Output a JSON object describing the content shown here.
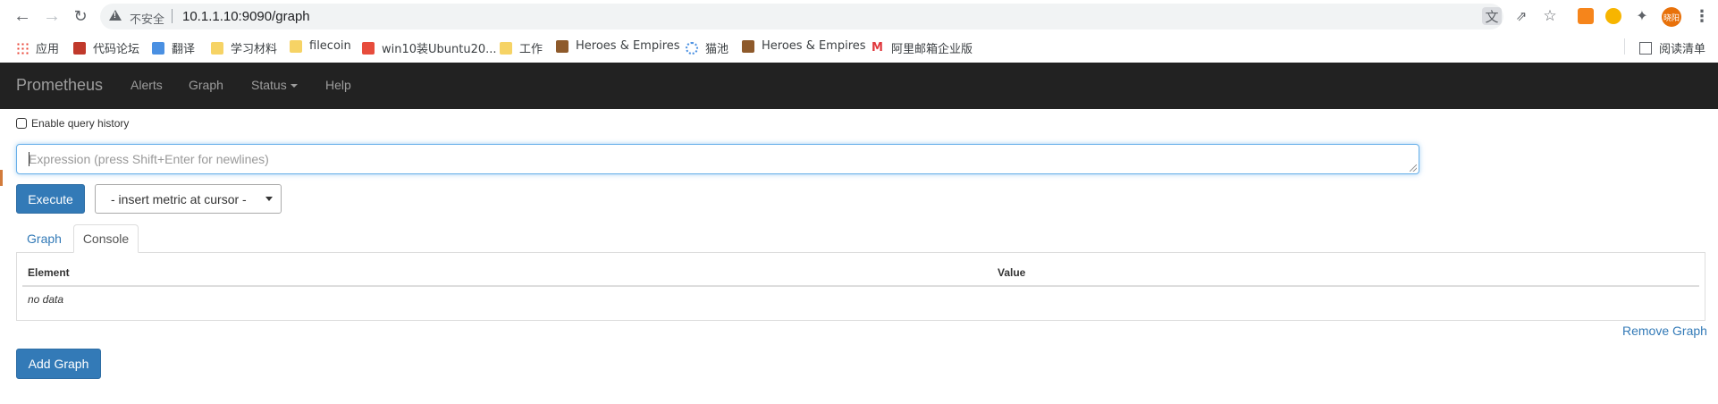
{
  "browser": {
    "url": "10.1.1.10:9090/graph",
    "security_label": "不安全",
    "profile_label": "晓阳",
    "icons": [
      "back-icon",
      "forward-icon",
      "reload-icon",
      "warning-icon",
      "translate-icon",
      "share-icon",
      "star-icon",
      "metamask-icon",
      "paragraph-icon",
      "extensions-icon",
      "menu-icon"
    ]
  },
  "bookmarks": {
    "items": [
      {
        "label": "应用",
        "icon": "apps-grid-icon"
      },
      {
        "label": "代码论坛",
        "icon": "fc-icon"
      },
      {
        "label": "翻译",
        "icon": "translate-icon"
      },
      {
        "label": "学习材料",
        "icon": "folder-icon"
      },
      {
        "label": "filecoin",
        "icon": "folder-icon"
      },
      {
        "label": "win10装Ubuntu20...",
        "icon": "c-icon"
      },
      {
        "label": "工作",
        "icon": "folder-icon"
      },
      {
        "label": "Heroes & Empires",
        "icon": "game-icon"
      },
      {
        "label": "猫池",
        "icon": "spinner-icon"
      },
      {
        "label": "Heroes & Empires",
        "icon": "game-icon"
      },
      {
        "label": "阿里邮箱企业版",
        "icon": "mail-icon"
      }
    ],
    "reading_list": "阅读清单"
  },
  "navbar": {
    "brand": "Prometheus",
    "links": {
      "alerts": "Alerts",
      "graph": "Graph",
      "status": "Status",
      "help": "Help"
    }
  },
  "query": {
    "history_label": "Enable query history",
    "expression_placeholder": "Expression (press Shift+Enter for newlines)",
    "execute_label": "Execute",
    "metric_select": "- insert metric at cursor -"
  },
  "panel": {
    "tabs": {
      "graph": "Graph",
      "console": "Console"
    },
    "columns": {
      "element": "Element",
      "value": "Value"
    },
    "empty_text": "no data",
    "remove_label": "Remove Graph"
  },
  "add_graph_label": "Add Graph",
  "colors": {
    "navbar": "#222222",
    "primary": "#337ab7",
    "link": "#337ab7",
    "nav_text": "#9d9d9d"
  }
}
